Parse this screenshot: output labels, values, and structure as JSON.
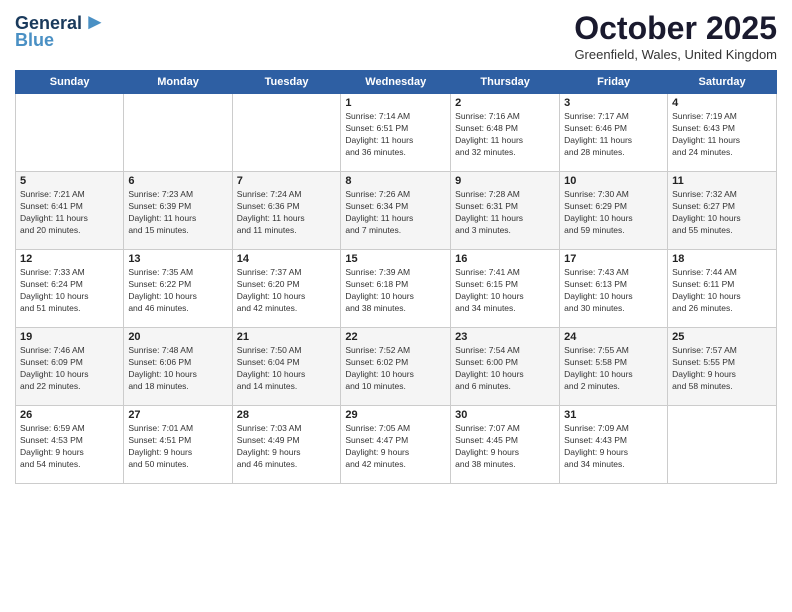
{
  "logo": {
    "line1": "General",
    "line2": "Blue"
  },
  "title": "October 2025",
  "subtitle": "Greenfield, Wales, United Kingdom",
  "days_of_week": [
    "Sunday",
    "Monday",
    "Tuesday",
    "Wednesday",
    "Thursday",
    "Friday",
    "Saturday"
  ],
  "weeks": [
    {
      "cells": [
        {
          "day": "",
          "info": ""
        },
        {
          "day": "",
          "info": ""
        },
        {
          "day": "",
          "info": ""
        },
        {
          "day": "1",
          "info": "Sunrise: 7:14 AM\nSunset: 6:51 PM\nDaylight: 11 hours\nand 36 minutes."
        },
        {
          "day": "2",
          "info": "Sunrise: 7:16 AM\nSunset: 6:48 PM\nDaylight: 11 hours\nand 32 minutes."
        },
        {
          "day": "3",
          "info": "Sunrise: 7:17 AM\nSunset: 6:46 PM\nDaylight: 11 hours\nand 28 minutes."
        },
        {
          "day": "4",
          "info": "Sunrise: 7:19 AM\nSunset: 6:43 PM\nDaylight: 11 hours\nand 24 minutes."
        }
      ]
    },
    {
      "cells": [
        {
          "day": "5",
          "info": "Sunrise: 7:21 AM\nSunset: 6:41 PM\nDaylight: 11 hours\nand 20 minutes."
        },
        {
          "day": "6",
          "info": "Sunrise: 7:23 AM\nSunset: 6:39 PM\nDaylight: 11 hours\nand 15 minutes."
        },
        {
          "day": "7",
          "info": "Sunrise: 7:24 AM\nSunset: 6:36 PM\nDaylight: 11 hours\nand 11 minutes."
        },
        {
          "day": "8",
          "info": "Sunrise: 7:26 AM\nSunset: 6:34 PM\nDaylight: 11 hours\nand 7 minutes."
        },
        {
          "day": "9",
          "info": "Sunrise: 7:28 AM\nSunset: 6:31 PM\nDaylight: 11 hours\nand 3 minutes."
        },
        {
          "day": "10",
          "info": "Sunrise: 7:30 AM\nSunset: 6:29 PM\nDaylight: 10 hours\nand 59 minutes."
        },
        {
          "day": "11",
          "info": "Sunrise: 7:32 AM\nSunset: 6:27 PM\nDaylight: 10 hours\nand 55 minutes."
        }
      ]
    },
    {
      "cells": [
        {
          "day": "12",
          "info": "Sunrise: 7:33 AM\nSunset: 6:24 PM\nDaylight: 10 hours\nand 51 minutes."
        },
        {
          "day": "13",
          "info": "Sunrise: 7:35 AM\nSunset: 6:22 PM\nDaylight: 10 hours\nand 46 minutes."
        },
        {
          "day": "14",
          "info": "Sunrise: 7:37 AM\nSunset: 6:20 PM\nDaylight: 10 hours\nand 42 minutes."
        },
        {
          "day": "15",
          "info": "Sunrise: 7:39 AM\nSunset: 6:18 PM\nDaylight: 10 hours\nand 38 minutes."
        },
        {
          "day": "16",
          "info": "Sunrise: 7:41 AM\nSunset: 6:15 PM\nDaylight: 10 hours\nand 34 minutes."
        },
        {
          "day": "17",
          "info": "Sunrise: 7:43 AM\nSunset: 6:13 PM\nDaylight: 10 hours\nand 30 minutes."
        },
        {
          "day": "18",
          "info": "Sunrise: 7:44 AM\nSunset: 6:11 PM\nDaylight: 10 hours\nand 26 minutes."
        }
      ]
    },
    {
      "cells": [
        {
          "day": "19",
          "info": "Sunrise: 7:46 AM\nSunset: 6:09 PM\nDaylight: 10 hours\nand 22 minutes."
        },
        {
          "day": "20",
          "info": "Sunrise: 7:48 AM\nSunset: 6:06 PM\nDaylight: 10 hours\nand 18 minutes."
        },
        {
          "day": "21",
          "info": "Sunrise: 7:50 AM\nSunset: 6:04 PM\nDaylight: 10 hours\nand 14 minutes."
        },
        {
          "day": "22",
          "info": "Sunrise: 7:52 AM\nSunset: 6:02 PM\nDaylight: 10 hours\nand 10 minutes."
        },
        {
          "day": "23",
          "info": "Sunrise: 7:54 AM\nSunset: 6:00 PM\nDaylight: 10 hours\nand 6 minutes."
        },
        {
          "day": "24",
          "info": "Sunrise: 7:55 AM\nSunset: 5:58 PM\nDaylight: 10 hours\nand 2 minutes."
        },
        {
          "day": "25",
          "info": "Sunrise: 7:57 AM\nSunset: 5:55 PM\nDaylight: 9 hours\nand 58 minutes."
        }
      ]
    },
    {
      "cells": [
        {
          "day": "26",
          "info": "Sunrise: 6:59 AM\nSunset: 4:53 PM\nDaylight: 9 hours\nand 54 minutes."
        },
        {
          "day": "27",
          "info": "Sunrise: 7:01 AM\nSunset: 4:51 PM\nDaylight: 9 hours\nand 50 minutes."
        },
        {
          "day": "28",
          "info": "Sunrise: 7:03 AM\nSunset: 4:49 PM\nDaylight: 9 hours\nand 46 minutes."
        },
        {
          "day": "29",
          "info": "Sunrise: 7:05 AM\nSunset: 4:47 PM\nDaylight: 9 hours\nand 42 minutes."
        },
        {
          "day": "30",
          "info": "Sunrise: 7:07 AM\nSunset: 4:45 PM\nDaylight: 9 hours\nand 38 minutes."
        },
        {
          "day": "31",
          "info": "Sunrise: 7:09 AM\nSunset: 4:43 PM\nDaylight: 9 hours\nand 34 minutes."
        },
        {
          "day": "",
          "info": ""
        }
      ]
    }
  ]
}
